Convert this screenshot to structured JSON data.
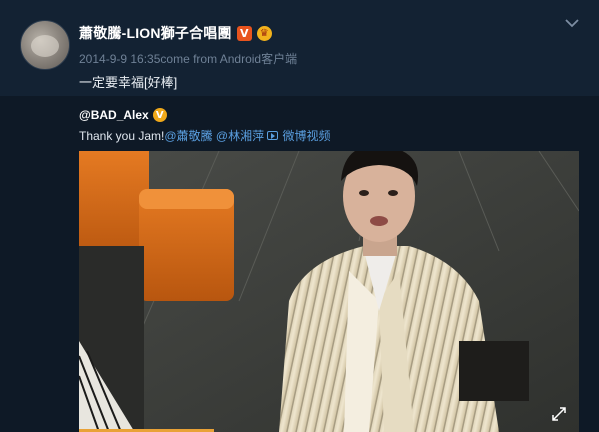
{
  "post": {
    "username": "蕭敬騰-LION獅子合唱團",
    "verified_badge": "V",
    "member_badge": "crown-icon",
    "meta": "2014-9-9 16:35come from Android客户端",
    "text": "一定要幸福[好棒]",
    "menu_icon": "chevron-down-icon"
  },
  "repost": {
    "username": "@BAD_Alex",
    "verified_badge": "V",
    "text_prefix": "Thank you Jam!",
    "mention_1": "@蕭敬騰",
    "mention_2": "@林湘萍",
    "video_link": "微博视频",
    "video": {
      "fullscreen_icon": "expand-icon",
      "progress": 0.27
    }
  },
  "colors": {
    "background": "#0f1a27",
    "post_background": "#132233",
    "link": "#5a9fe0",
    "v_badge": "#e8541e",
    "gold_badge": "#f0a91a",
    "progress": "#e9a237"
  }
}
